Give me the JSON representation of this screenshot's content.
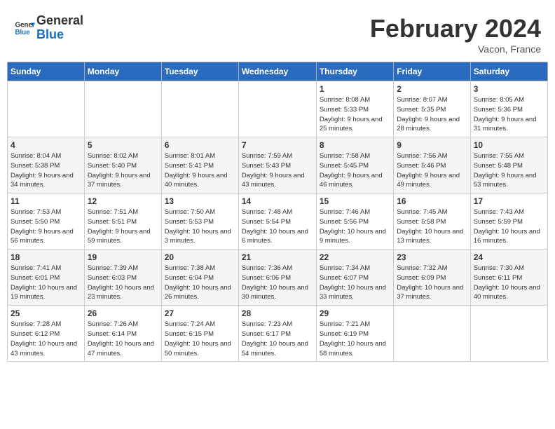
{
  "header": {
    "logo_general": "General",
    "logo_blue": "Blue",
    "title": "February 2024",
    "location": "Vacon, France"
  },
  "weekdays": [
    "Sunday",
    "Monday",
    "Tuesday",
    "Wednesday",
    "Thursday",
    "Friday",
    "Saturday"
  ],
  "weeks": [
    [
      {
        "day": "",
        "sunrise": "",
        "sunset": "",
        "daylight": ""
      },
      {
        "day": "",
        "sunrise": "",
        "sunset": "",
        "daylight": ""
      },
      {
        "day": "",
        "sunrise": "",
        "sunset": "",
        "daylight": ""
      },
      {
        "day": "",
        "sunrise": "",
        "sunset": "",
        "daylight": ""
      },
      {
        "day": "1",
        "sunrise": "Sunrise: 8:08 AM",
        "sunset": "Sunset: 5:33 PM",
        "daylight": "Daylight: 9 hours and 25 minutes."
      },
      {
        "day": "2",
        "sunrise": "Sunrise: 8:07 AM",
        "sunset": "Sunset: 5:35 PM",
        "daylight": "Daylight: 9 hours and 28 minutes."
      },
      {
        "day": "3",
        "sunrise": "Sunrise: 8:05 AM",
        "sunset": "Sunset: 5:36 PM",
        "daylight": "Daylight: 9 hours and 31 minutes."
      }
    ],
    [
      {
        "day": "4",
        "sunrise": "Sunrise: 8:04 AM",
        "sunset": "Sunset: 5:38 PM",
        "daylight": "Daylight: 9 hours and 34 minutes."
      },
      {
        "day": "5",
        "sunrise": "Sunrise: 8:02 AM",
        "sunset": "Sunset: 5:40 PM",
        "daylight": "Daylight: 9 hours and 37 minutes."
      },
      {
        "day": "6",
        "sunrise": "Sunrise: 8:01 AM",
        "sunset": "Sunset: 5:41 PM",
        "daylight": "Daylight: 9 hours and 40 minutes."
      },
      {
        "day": "7",
        "sunrise": "Sunrise: 7:59 AM",
        "sunset": "Sunset: 5:43 PM",
        "daylight": "Daylight: 9 hours and 43 minutes."
      },
      {
        "day": "8",
        "sunrise": "Sunrise: 7:58 AM",
        "sunset": "Sunset: 5:45 PM",
        "daylight": "Daylight: 9 hours and 46 minutes."
      },
      {
        "day": "9",
        "sunrise": "Sunrise: 7:56 AM",
        "sunset": "Sunset: 5:46 PM",
        "daylight": "Daylight: 9 hours and 49 minutes."
      },
      {
        "day": "10",
        "sunrise": "Sunrise: 7:55 AM",
        "sunset": "Sunset: 5:48 PM",
        "daylight": "Daylight: 9 hours and 53 minutes."
      }
    ],
    [
      {
        "day": "11",
        "sunrise": "Sunrise: 7:53 AM",
        "sunset": "Sunset: 5:50 PM",
        "daylight": "Daylight: 9 hours and 56 minutes."
      },
      {
        "day": "12",
        "sunrise": "Sunrise: 7:51 AM",
        "sunset": "Sunset: 5:51 PM",
        "daylight": "Daylight: 9 hours and 59 minutes."
      },
      {
        "day": "13",
        "sunrise": "Sunrise: 7:50 AM",
        "sunset": "Sunset: 5:53 PM",
        "daylight": "Daylight: 10 hours and 3 minutes."
      },
      {
        "day": "14",
        "sunrise": "Sunrise: 7:48 AM",
        "sunset": "Sunset: 5:54 PM",
        "daylight": "Daylight: 10 hours and 6 minutes."
      },
      {
        "day": "15",
        "sunrise": "Sunrise: 7:46 AM",
        "sunset": "Sunset: 5:56 PM",
        "daylight": "Daylight: 10 hours and 9 minutes."
      },
      {
        "day": "16",
        "sunrise": "Sunrise: 7:45 AM",
        "sunset": "Sunset: 5:58 PM",
        "daylight": "Daylight: 10 hours and 13 minutes."
      },
      {
        "day": "17",
        "sunrise": "Sunrise: 7:43 AM",
        "sunset": "Sunset: 5:59 PM",
        "daylight": "Daylight: 10 hours and 16 minutes."
      }
    ],
    [
      {
        "day": "18",
        "sunrise": "Sunrise: 7:41 AM",
        "sunset": "Sunset: 6:01 PM",
        "daylight": "Daylight: 10 hours and 19 minutes."
      },
      {
        "day": "19",
        "sunrise": "Sunrise: 7:39 AM",
        "sunset": "Sunset: 6:03 PM",
        "daylight": "Daylight: 10 hours and 23 minutes."
      },
      {
        "day": "20",
        "sunrise": "Sunrise: 7:38 AM",
        "sunset": "Sunset: 6:04 PM",
        "daylight": "Daylight: 10 hours and 26 minutes."
      },
      {
        "day": "21",
        "sunrise": "Sunrise: 7:36 AM",
        "sunset": "Sunset: 6:06 PM",
        "daylight": "Daylight: 10 hours and 30 minutes."
      },
      {
        "day": "22",
        "sunrise": "Sunrise: 7:34 AM",
        "sunset": "Sunset: 6:07 PM",
        "daylight": "Daylight: 10 hours and 33 minutes."
      },
      {
        "day": "23",
        "sunrise": "Sunrise: 7:32 AM",
        "sunset": "Sunset: 6:09 PM",
        "daylight": "Daylight: 10 hours and 37 minutes."
      },
      {
        "day": "24",
        "sunrise": "Sunrise: 7:30 AM",
        "sunset": "Sunset: 6:11 PM",
        "daylight": "Daylight: 10 hours and 40 minutes."
      }
    ],
    [
      {
        "day": "25",
        "sunrise": "Sunrise: 7:28 AM",
        "sunset": "Sunset: 6:12 PM",
        "daylight": "Daylight: 10 hours and 43 minutes."
      },
      {
        "day": "26",
        "sunrise": "Sunrise: 7:26 AM",
        "sunset": "Sunset: 6:14 PM",
        "daylight": "Daylight: 10 hours and 47 minutes."
      },
      {
        "day": "27",
        "sunrise": "Sunrise: 7:24 AM",
        "sunset": "Sunset: 6:15 PM",
        "daylight": "Daylight: 10 hours and 50 minutes."
      },
      {
        "day": "28",
        "sunrise": "Sunrise: 7:23 AM",
        "sunset": "Sunset: 6:17 PM",
        "daylight": "Daylight: 10 hours and 54 minutes."
      },
      {
        "day": "29",
        "sunrise": "Sunrise: 7:21 AM",
        "sunset": "Sunset: 6:19 PM",
        "daylight": "Daylight: 10 hours and 58 minutes."
      },
      {
        "day": "",
        "sunrise": "",
        "sunset": "",
        "daylight": ""
      },
      {
        "day": "",
        "sunrise": "",
        "sunset": "",
        "daylight": ""
      }
    ]
  ]
}
